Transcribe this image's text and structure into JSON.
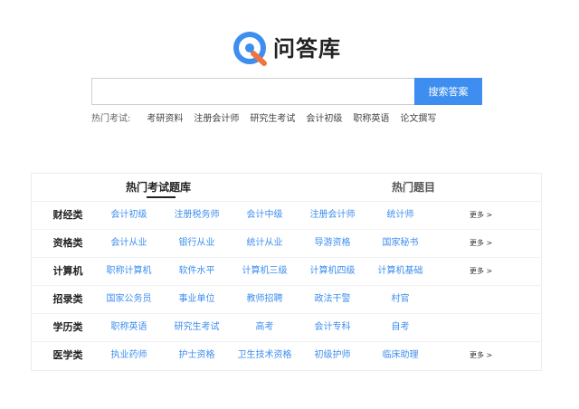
{
  "brand": {
    "name": "问答库",
    "logo_color": "#3d8ef0"
  },
  "search": {
    "value": "",
    "placeholder": "",
    "button_label": "搜索答案",
    "button_color": "#3d8ef0"
  },
  "hot_searches": {
    "label": "热门考试:",
    "items": [
      "考研资料",
      "注册会计师",
      "研究生考试",
      "会计初级",
      "职称英语",
      "论文撰写"
    ]
  },
  "panel": {
    "tabs": [
      {
        "label": "热门考试题库",
        "active": true
      },
      {
        "label": "热门题目",
        "active": false
      }
    ],
    "more_label": "更多 >",
    "rows": [
      {
        "category": "财经类",
        "items": [
          "会计初级",
          "注册税务师",
          "会计中级",
          "注册会计师",
          "统计师"
        ]
      },
      {
        "category": "资格类",
        "items": [
          "会计从业",
          "银行从业",
          "统计从业",
          "导游资格",
          "国家秘书"
        ]
      },
      {
        "category": "计算机",
        "items": [
          "职称计算机",
          "软件水平",
          "计算机三级",
          "计算机四级",
          "计算机基础"
        ]
      },
      {
        "category": "招录类",
        "items": [
          "国家公务员",
          "事业单位",
          "教师招聘",
          "政法干警",
          "村官"
        ]
      },
      {
        "category": "学历类",
        "items": [
          "职称英语",
          "研究生考试",
          "高考",
          "会计专科",
          "自考"
        ]
      },
      {
        "category": "医学类",
        "items": [
          "执业药师",
          "护士资格",
          "卫生技术资格",
          "初级护师",
          "临床助理"
        ]
      }
    ]
  }
}
